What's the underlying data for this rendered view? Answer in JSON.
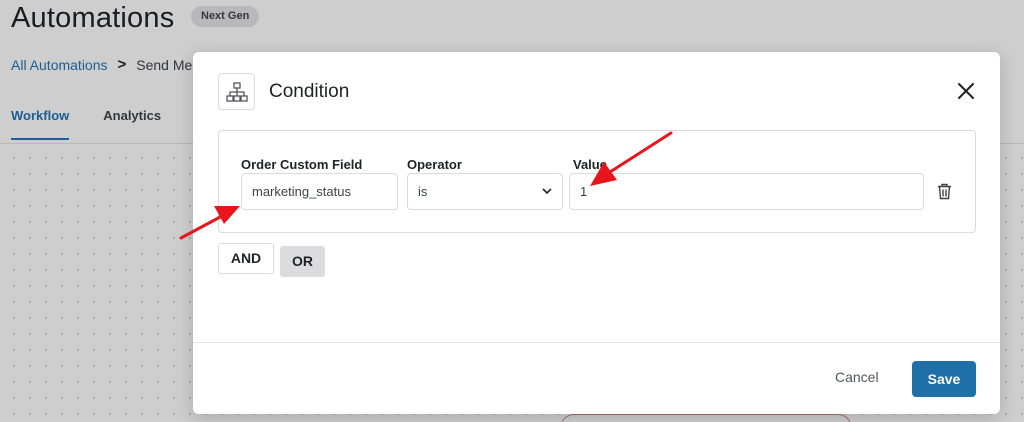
{
  "page": {
    "title": "Automations",
    "badge": "Next Gen",
    "breadcrumb": {
      "link": "All Automations",
      "separator": ">",
      "current": "Send Me"
    },
    "tabs": [
      {
        "label": "Workflow",
        "active": true
      },
      {
        "label": "Analytics",
        "active": false
      }
    ]
  },
  "modal": {
    "title": "Condition",
    "icon": "sitemap-icon",
    "condition": {
      "custom_field_label": "Order Custom Field",
      "custom_field_value": "marketing_status",
      "operator_label": "Operator",
      "operator_value": "is",
      "value_label": "Value",
      "value_value": "1"
    },
    "and_label": "AND",
    "or_label": "OR",
    "cancel_label": "Cancel",
    "save_label": "Save"
  },
  "colors": {
    "primary": "#1f6fa8",
    "link": "#2271b1",
    "annotation_arrow": "#e8161c"
  }
}
